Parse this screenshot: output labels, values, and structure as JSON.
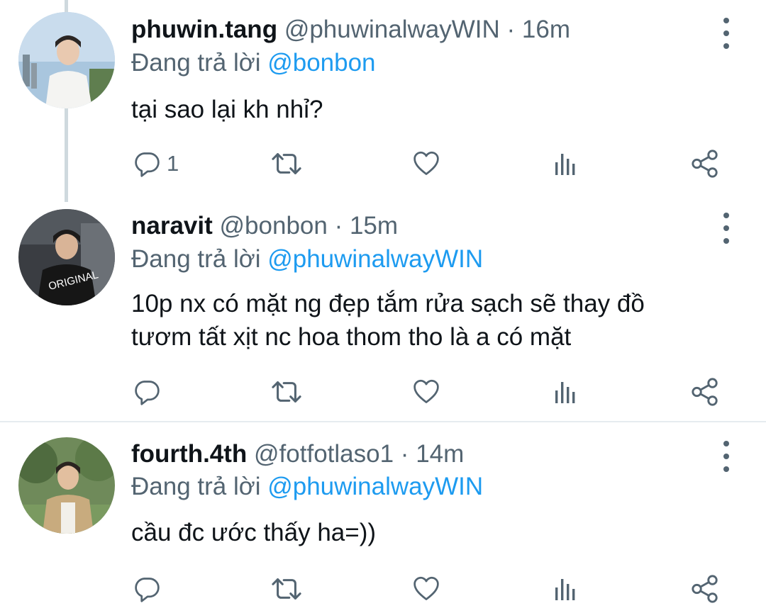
{
  "colors": {
    "text": "#0f1419",
    "secondary": "#536471",
    "mention": "#1d9bf0",
    "icon": "#536471",
    "thread_line": "#cfd9de",
    "divider": "#e6ecf0"
  },
  "tweets": [
    {
      "display_name": "phuwin.tang",
      "handle": "@phuwinalwayWIN",
      "separator": "·",
      "time": "16m",
      "replying_prefix": "Đang trả lời",
      "replying_to": "@bonbon",
      "text_lines": [
        "tại sao lại kh nhỉ?"
      ],
      "reply_count": "1",
      "icons": [
        "more-vertical-icon",
        "reply-icon",
        "retweet-icon",
        "like-icon",
        "analytics-icon",
        "share-icon"
      ]
    },
    {
      "display_name": "naravit",
      "handle": "@bonbon",
      "separator": "·",
      "time": "15m",
      "replying_prefix": "Đang trả lời",
      "replying_to": "@phuwinalwayWIN",
      "text_lines": [
        "10p nx có mặt ng đẹp tắm rửa sạch sẽ thay đồ",
        "tươm tất xịt nc hoa thom tho là a có mặt"
      ],
      "reply_count": "",
      "icons": [
        "more-vertical-icon",
        "reply-icon",
        "retweet-icon",
        "like-icon",
        "analytics-icon",
        "share-icon"
      ]
    },
    {
      "display_name": "fourth.4th",
      "handle": "@fotfotlaso1",
      "separator": "·",
      "time": "14m",
      "replying_prefix": "Đang trả lời",
      "replying_to": "@phuwinalwayWIN",
      "text_lines": [
        "cầu đc ước thấy ha=))"
      ],
      "reply_count": "",
      "icons": [
        "more-vertical-icon",
        "reply-icon",
        "retweet-icon",
        "like-icon",
        "analytics-icon",
        "share-icon"
      ]
    }
  ]
}
